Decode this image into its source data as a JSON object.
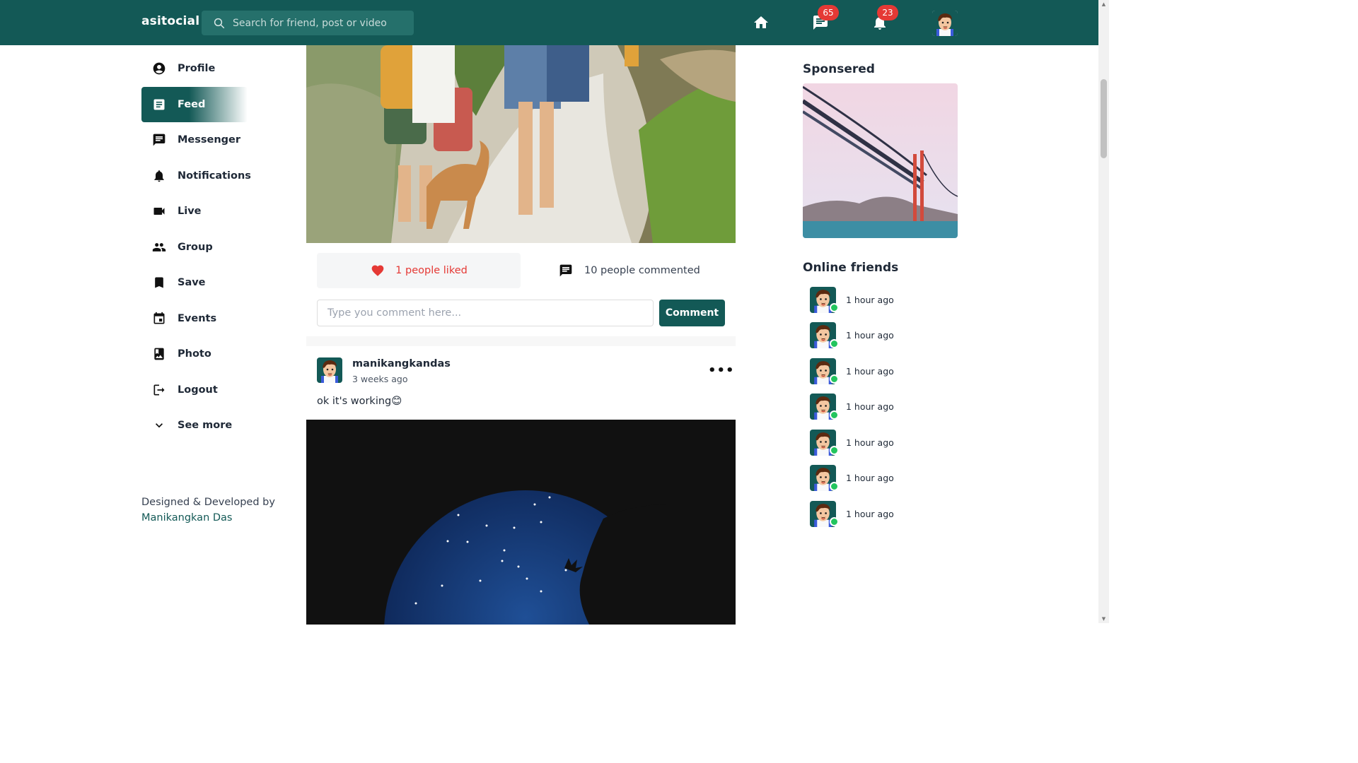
{
  "header": {
    "brand": "asitocial",
    "search_placeholder": "Search for friend, post or video",
    "home_icon": "home-icon",
    "messages_badge": "65",
    "notifications_badge": "23"
  },
  "sidebar": {
    "items": [
      {
        "label": "Profile",
        "icon": "account-circle-icon"
      },
      {
        "label": "Feed",
        "icon": "feed-icon",
        "active": true
      },
      {
        "label": "Messenger",
        "icon": "chat-icon"
      },
      {
        "label": "Notifications",
        "icon": "bell-icon"
      },
      {
        "label": "Live",
        "icon": "videocam-icon"
      },
      {
        "label": "Group",
        "icon": "group-icon"
      },
      {
        "label": "Save",
        "icon": "bookmark-icon"
      },
      {
        "label": "Events",
        "icon": "calendar-icon"
      },
      {
        "label": "Photo",
        "icon": "photo-album-icon"
      },
      {
        "label": "Logout",
        "icon": "logout-icon"
      },
      {
        "label": "See more",
        "icon": "chevron-down-icon"
      }
    ],
    "footer_line": "Designed & Developed by",
    "footer_author": "Manikangkan Das"
  },
  "feed": {
    "post1": {
      "likes": "1 people liked",
      "comments": "10 people commented",
      "comment_placeholder": "Type you comment here...",
      "comment_button": "Comment"
    },
    "post2": {
      "username": "manikangkandas",
      "time": "3 weeks ago",
      "text": "ok it's working😊"
    }
  },
  "right": {
    "sponsored_title": "Sponsered",
    "online_title": "Online friends",
    "friends": [
      {
        "time": "1 hour ago"
      },
      {
        "time": "1 hour ago"
      },
      {
        "time": "1 hour ago"
      },
      {
        "time": "1 hour ago"
      },
      {
        "time": "1 hour ago"
      },
      {
        "time": "1 hour ago"
      },
      {
        "time": "1 hour ago"
      }
    ]
  },
  "colors": {
    "primary": "#135956",
    "badge": "#e53935",
    "like": "#e53935",
    "online": "#22c55e"
  }
}
